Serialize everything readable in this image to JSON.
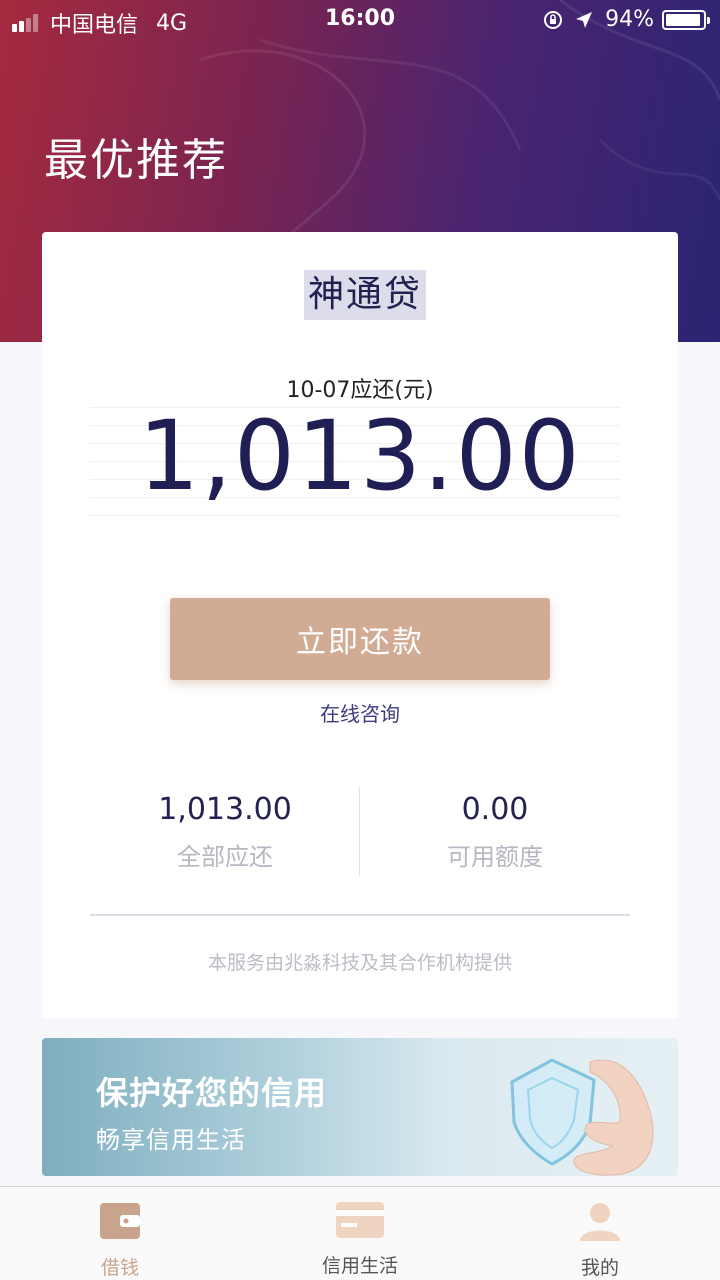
{
  "status_bar": {
    "carrier": "中国电信",
    "network": "4G",
    "time": "16:00",
    "battery": "94%",
    "battery_level": 0.94
  },
  "page": {
    "title": "最优推荐"
  },
  "loan_card": {
    "product_name": "神通贷",
    "due_label": "10-07应还(元)",
    "due_amount": "1,013.00",
    "pay_button": "立即还款",
    "consult_link": "在线咨询",
    "stats": [
      {
        "value": "1,013.00",
        "label": "全部应还"
      },
      {
        "value": "0.00",
        "label": "可用额度"
      }
    ],
    "provider_note": "本服务由兆淼科技及其合作机构提供"
  },
  "banner": {
    "title": "保护好您的信用",
    "subtitle": "畅享信用生活"
  },
  "tabbar": {
    "items": [
      {
        "label": "借钱",
        "icon": "wallet-icon",
        "active": true
      },
      {
        "label": "信用生活",
        "icon": "credit-card-icon",
        "active": false
      },
      {
        "label": "我的",
        "icon": "user-icon",
        "active": false
      }
    ]
  },
  "colors": {
    "accent": "#d1ab94",
    "active_tab": "#c9a48c",
    "amount_text": "#1f1f55",
    "link": "#3d3a82"
  }
}
